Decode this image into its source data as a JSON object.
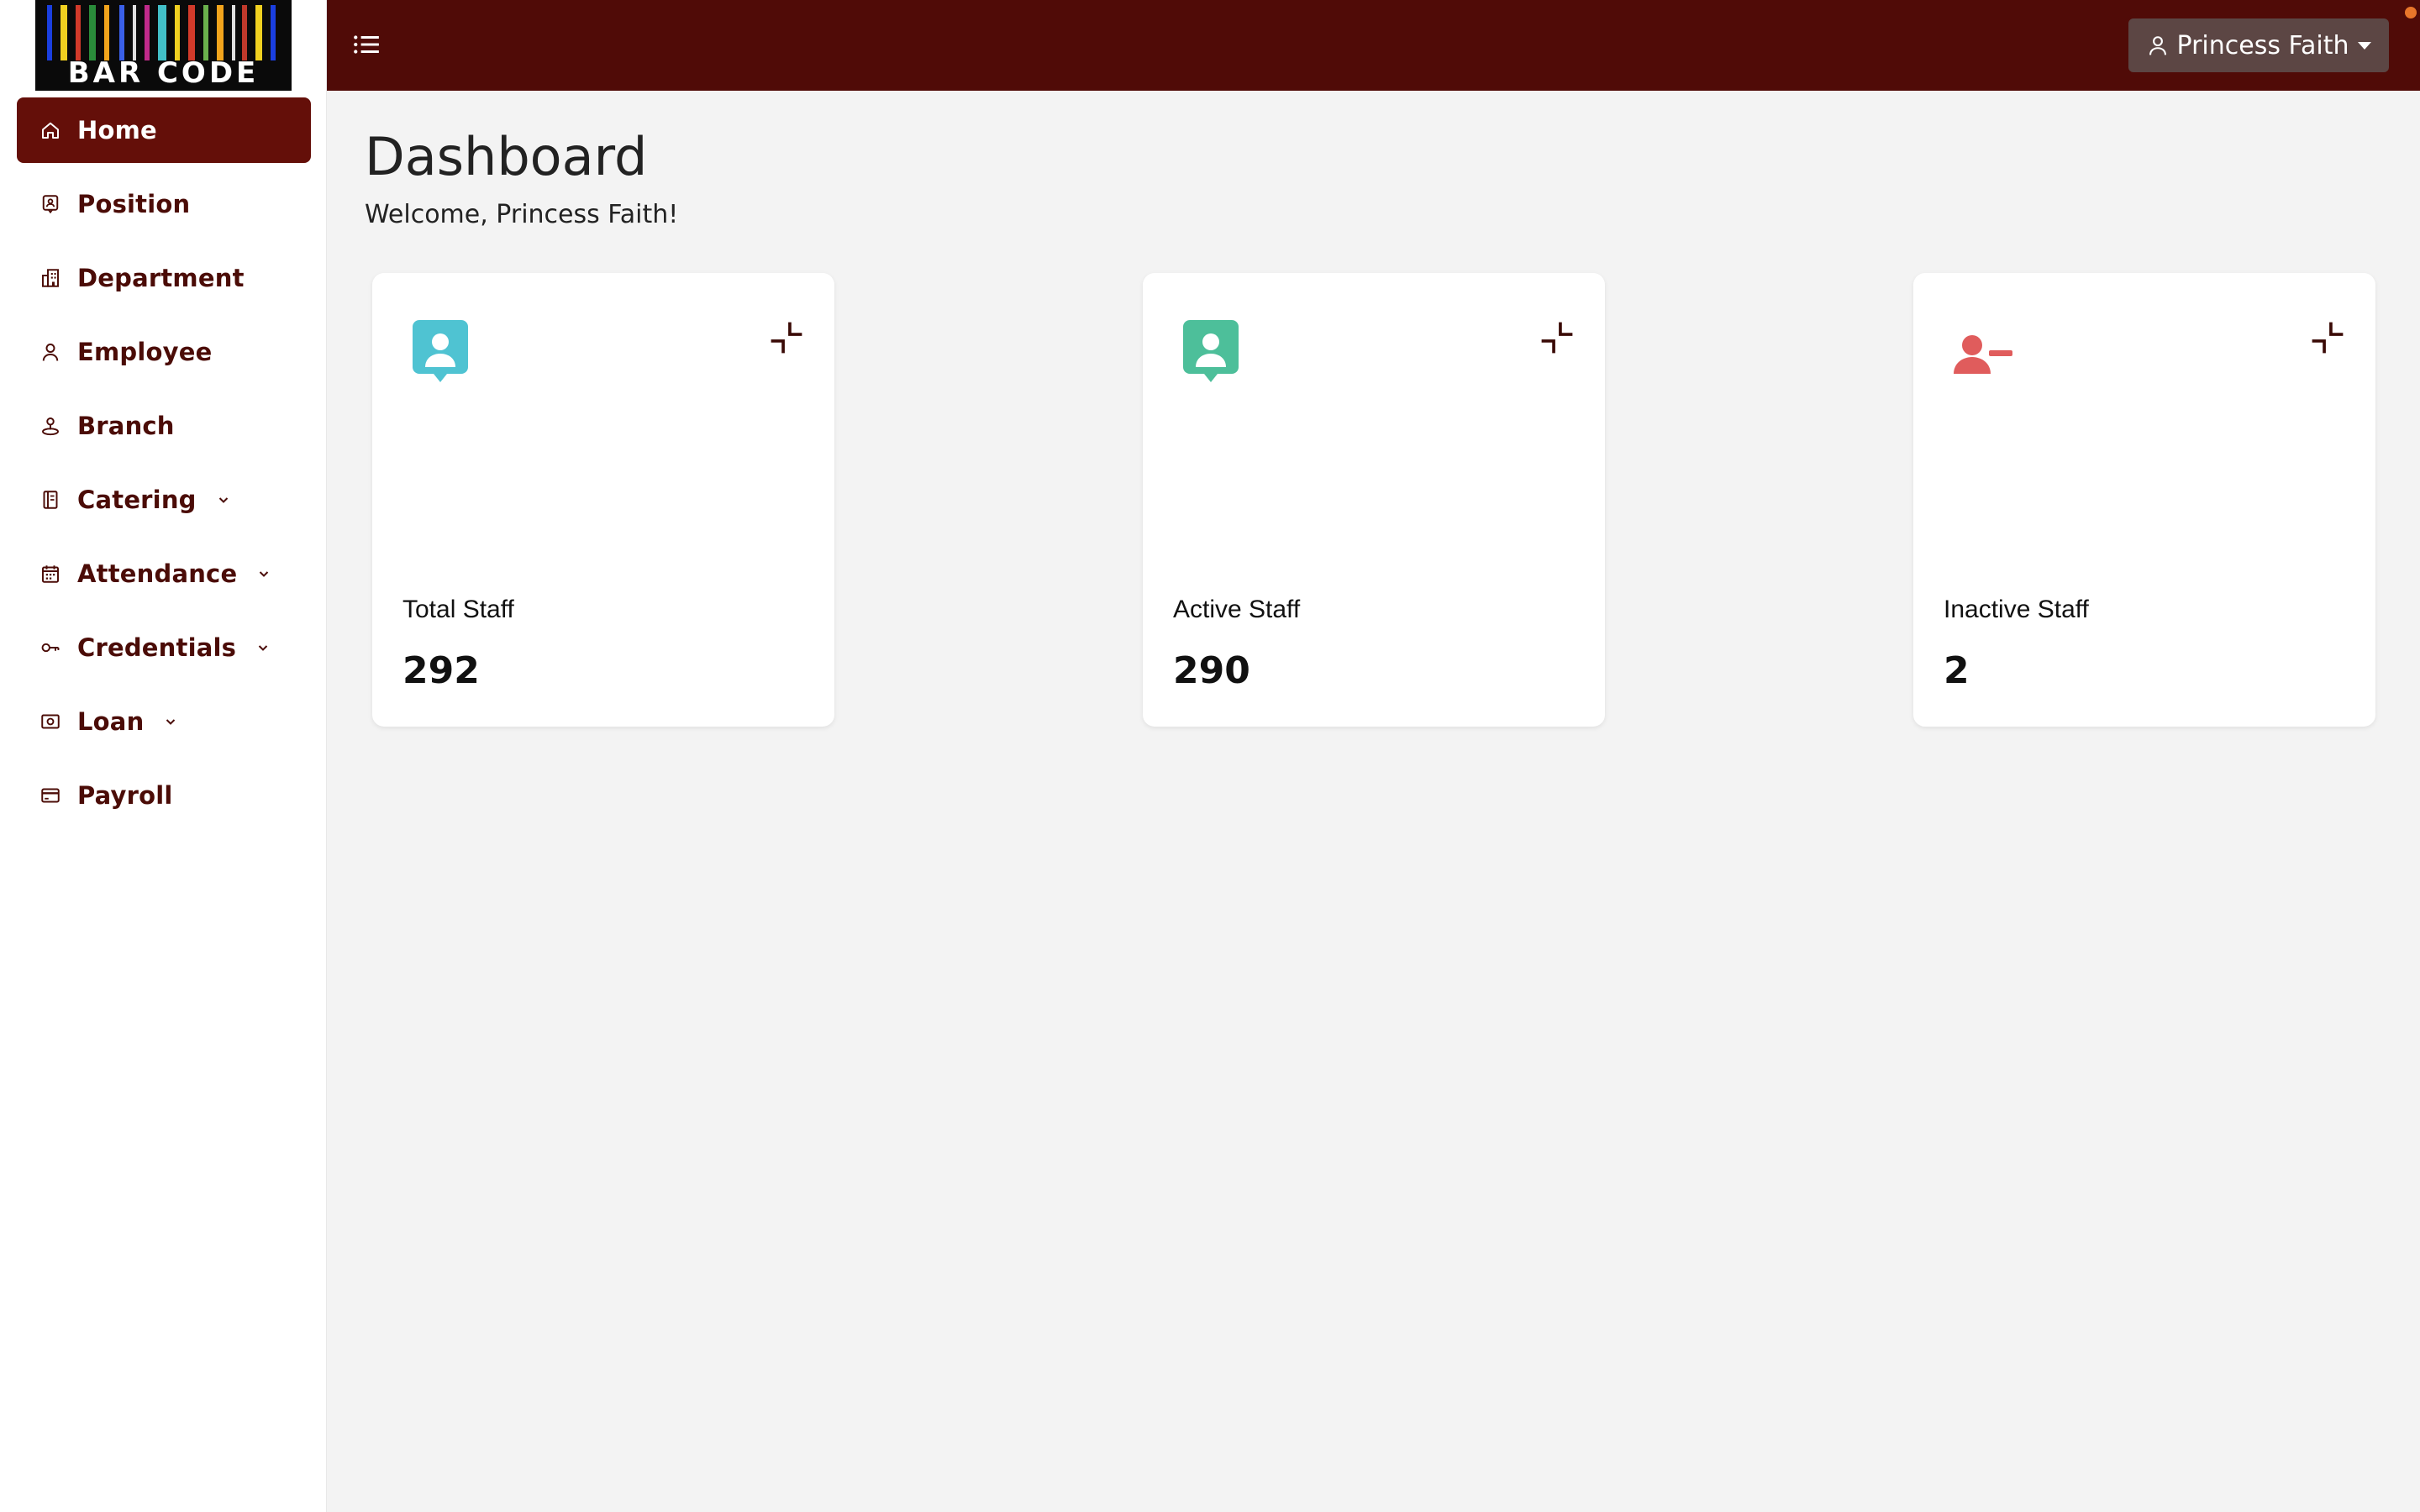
{
  "app": {
    "logo_text": "BAR CODE",
    "brand_color": "#500b07",
    "active_color": "#640f09"
  },
  "sidebar": {
    "items": [
      {
        "label": "Home",
        "icon": "home-icon",
        "active": true,
        "has_submenu": false
      },
      {
        "label": "Position",
        "icon": "id-badge-icon",
        "active": false,
        "has_submenu": false
      },
      {
        "label": "Department",
        "icon": "building-icon",
        "active": false,
        "has_submenu": false
      },
      {
        "label": "Employee",
        "icon": "user-icon",
        "active": false,
        "has_submenu": false
      },
      {
        "label": "Branch",
        "icon": "location-icon",
        "active": false,
        "has_submenu": false
      },
      {
        "label": "Catering",
        "icon": "notebook-icon",
        "active": false,
        "has_submenu": true
      },
      {
        "label": "Attendance",
        "icon": "calendar-icon",
        "active": false,
        "has_submenu": true
      },
      {
        "label": "Credentials",
        "icon": "key-icon",
        "active": false,
        "has_submenu": true
      },
      {
        "label": "Loan",
        "icon": "money-icon",
        "active": false,
        "has_submenu": true
      },
      {
        "label": "Payroll",
        "icon": "credit-card-icon",
        "active": false,
        "has_submenu": false
      }
    ]
  },
  "header": {
    "menu_icon": "list-icon",
    "user_name": "Princess Faith",
    "user_icon": "user-icon"
  },
  "main": {
    "title": "Dashboard",
    "welcome": "Welcome, Princess Faith!",
    "cards": [
      {
        "title": "Total Staff",
        "value": "292",
        "icon": "user-badge-icon",
        "color": "#4fc3d2"
      },
      {
        "title": "Active Staff",
        "value": "290",
        "icon": "user-badge-icon",
        "color": "#4dbf9a"
      },
      {
        "title": "Inactive Staff",
        "value": "2",
        "icon": "user-minus-icon",
        "color": "#e05c5c"
      }
    ]
  }
}
